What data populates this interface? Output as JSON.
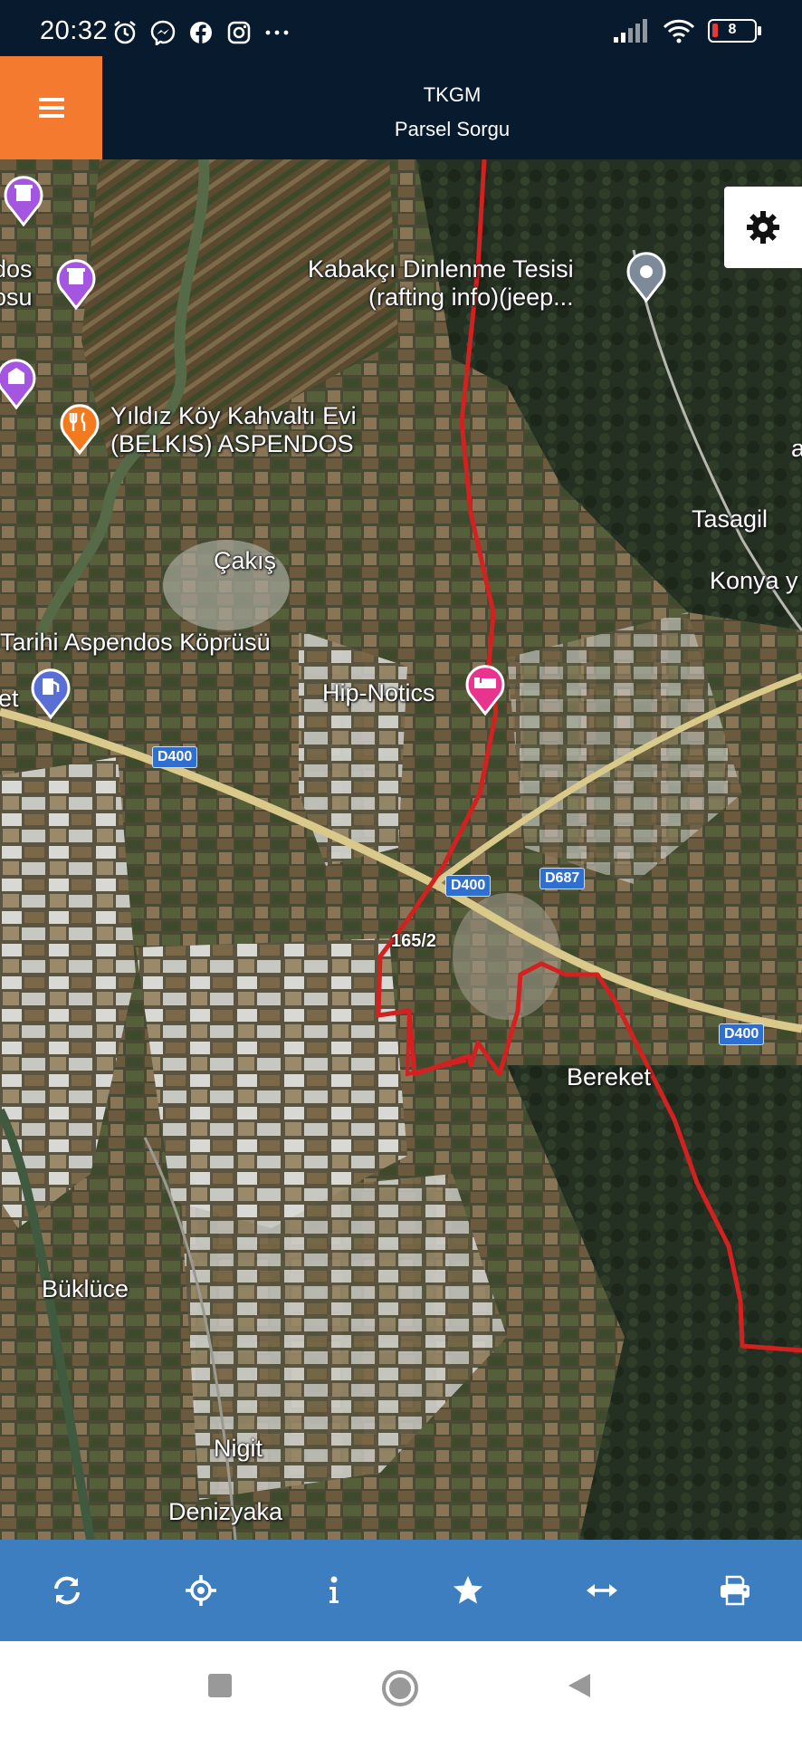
{
  "status_bar": {
    "time": "20:32",
    "icons": [
      "alarm-icon",
      "messenger-icon",
      "facebook-icon",
      "instagram-icon",
      "more-icon"
    ],
    "battery_level": "8",
    "signal": "signal-icon",
    "wifi": "wifi-icon"
  },
  "header": {
    "title": "TKGM",
    "subtitle": "Parsel Sorgu",
    "menu_icon": "hamburger-menu-icon",
    "accent_color": "#f47a30",
    "bg_color": "#071a2e"
  },
  "map": {
    "labels": {
      "kabakci": "Kabakçı Dinlenme Tesisi\n(rafting info)(jeep...",
      "dos": "dos\nosu",
      "yildiz": "Yıldız Köy Kahvaltı Evi\n(BELKIS) ASPENDOS",
      "tasagil": "Tasagil",
      "konya": "Konya y",
      "a_edge": "a",
      "cakis": "Çakış",
      "tarihi": "Tarihi Aspendos Köprüsü",
      "et": "et",
      "hip": "Hip-Notics",
      "bereket": "Bereket",
      "buklüce": "Büklüce",
      "nigit": "Nigit",
      "denizyaka": "Denizyaka"
    },
    "road_shields": {
      "d400_a": "D400",
      "d400_b": "D400",
      "d687": "D687",
      "d400_c": "D400"
    },
    "parcel_label": "165/2",
    "boundary_color": "#d32020",
    "settings_icon": "gear-icon"
  },
  "toolbar": {
    "items": [
      {
        "name": "refresh-icon"
      },
      {
        "name": "locate-icon"
      },
      {
        "name": "info-icon"
      },
      {
        "name": "star-icon"
      },
      {
        "name": "measure-icon"
      },
      {
        "name": "print-icon"
      }
    ],
    "bg_color": "#3d7ec0"
  },
  "nav_bar": {
    "items": [
      "recents-icon",
      "home-icon",
      "back-icon"
    ]
  }
}
